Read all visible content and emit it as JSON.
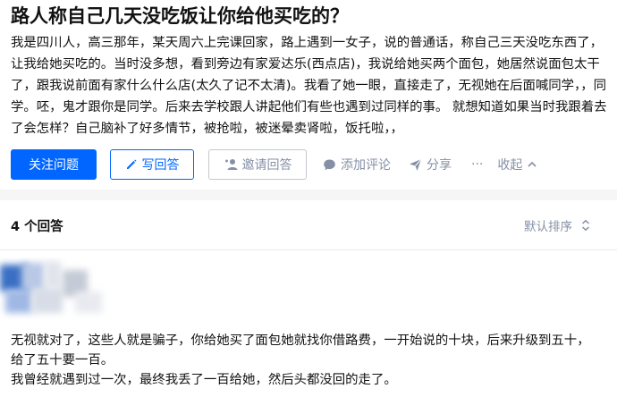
{
  "question": {
    "title": "路人称自己几天没吃饭让你给他买吃的？",
    "detail": "我是四川人，高三那年，某天周六上完课回家，路上遇到一女子，说的普通话，称自己三天没吃东西了，让我给她买吃的。当时没多想，看到旁边有家爱达乐(西点店)，我说给她买两个面包，她居然说面包太干了，跟我说前面有家什么什么店(太久了记不太清)。我看了她一眼，直接走了，无视她在后面喊同学，，同学。呸，鬼才跟你是同学。后来去学校跟人讲起他们有些也遇到过同样的事。 就想知道如果当时我跟着去了会怎样？自己脑补了好多情节，被抢啦，被迷晕卖肾啦，饭托啦，，"
  },
  "actions": {
    "follow": "关注问题",
    "write": "写回答",
    "invite": "邀请回答",
    "comment": "添加评论",
    "share": "分享",
    "more": "···",
    "collapse": "收起"
  },
  "answers": {
    "count": "4 个回答",
    "sort": "默认排序",
    "first": {
      "paragraphs": [
        "无视就对了，这些人就是骗子，你给她买了面包她就找你借路费，一开始说的十块，后来升级到五十，给了五十要一百。",
        "我曾经就遇到过一次，最终我丢了一百给她，然后头都没回的走了。"
      ]
    }
  },
  "colors": {
    "primary": "#0066ff",
    "muted": "#8590a6",
    "text": "#121212",
    "page_bg": "#f6f6f6"
  },
  "icons": {
    "write": "pencil-icon",
    "invite": "add-person-icon",
    "comment": "comment-bubble-icon",
    "share": "paper-plane-icon",
    "collapse": "chevron-up-icon",
    "sort": "sort-updown-icon"
  }
}
